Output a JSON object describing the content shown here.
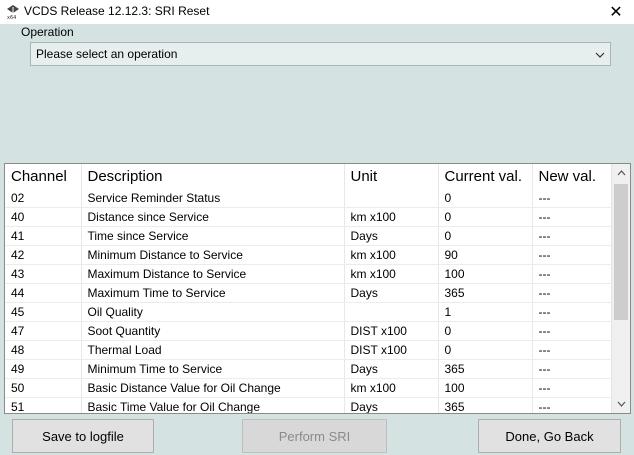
{
  "window": {
    "title": "VCDS Release 12.12.3:  SRI Reset",
    "close_glyph": "✕",
    "app_icon_label": "x64"
  },
  "operation": {
    "label": "Operation",
    "selected": "Please select an operation"
  },
  "table": {
    "headers": [
      "Channel",
      "Description",
      "Unit",
      "Current val.",
      "New val."
    ],
    "rows": [
      {
        "channel": "02",
        "description": "Service Reminder Status",
        "unit": "",
        "current": "0",
        "new": "---"
      },
      {
        "channel": "40",
        "description": "Distance since Service",
        "unit": "km x100",
        "current": "0",
        "new": "---"
      },
      {
        "channel": "41",
        "description": "Time since Service",
        "unit": "Days",
        "current": "0",
        "new": "---"
      },
      {
        "channel": "42",
        "description": "Minimum Distance to Service",
        "unit": "km x100",
        "current": "90",
        "new": "---"
      },
      {
        "channel": "43",
        "description": "Maximum Distance to Service",
        "unit": "km x100",
        "current": "100",
        "new": "---"
      },
      {
        "channel": "44",
        "description": "Maximum Time to Service",
        "unit": "Days",
        "current": "365",
        "new": "---"
      },
      {
        "channel": "45",
        "description": "Oil Quality",
        "unit": "",
        "current": "1",
        "new": "---"
      },
      {
        "channel": "47",
        "description": "Soot Quantity",
        "unit": "DIST x100",
        "current": "0",
        "new": "---"
      },
      {
        "channel": "48",
        "description": "Thermal Load",
        "unit": "DIST x100",
        "current": "0",
        "new": "---"
      },
      {
        "channel": "49",
        "description": "Minimum Time to Service",
        "unit": "Days",
        "current": "365",
        "new": "---"
      },
      {
        "channel": "50",
        "description": "Basic Distance Value for Oil Change",
        "unit": "km x100",
        "current": "100",
        "new": "---"
      },
      {
        "channel": "51",
        "description": "Basic Time Value for Oil Change",
        "unit": "Days",
        "current": "365",
        "new": "---"
      }
    ]
  },
  "buttons": {
    "save": "Save to logfile",
    "perform": "Perform SRI",
    "done": "Done, Go Back"
  }
}
